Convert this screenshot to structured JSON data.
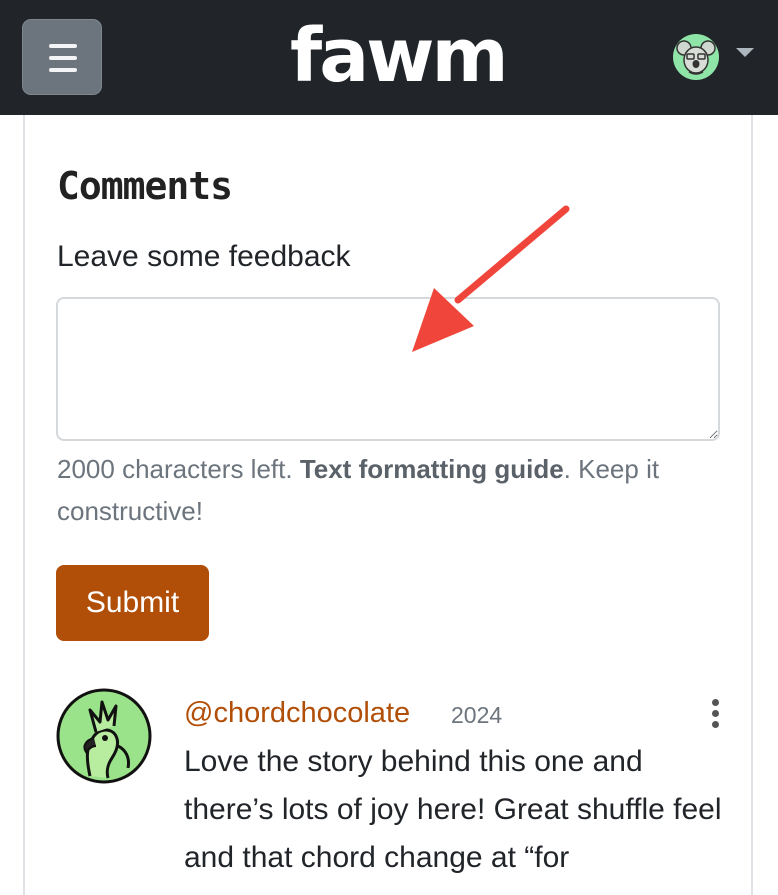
{
  "header": {
    "logo_text": "fawm",
    "menu_icon": "hamburger-menu-icon",
    "user_menu_caret": "caret-down-icon"
  },
  "comments_section": {
    "heading": "Comments",
    "field_label": "Leave some feedback",
    "textarea_value": "",
    "help_text_start": "2000 characters left. ",
    "help_link": "Text formatting guide",
    "help_text_end": ". Keep it constructive!",
    "submit_label": "Submit"
  },
  "comments": [
    {
      "username": "@chordchocolate",
      "year": "2024",
      "body": "Love the story behind this one and there’s lots of joy here! Great shuffle feel and that chord change at “for"
    }
  ],
  "colors": {
    "navbar": "#212529",
    "accent": "#b14e07",
    "annotation_arrow": "#f0453a"
  }
}
